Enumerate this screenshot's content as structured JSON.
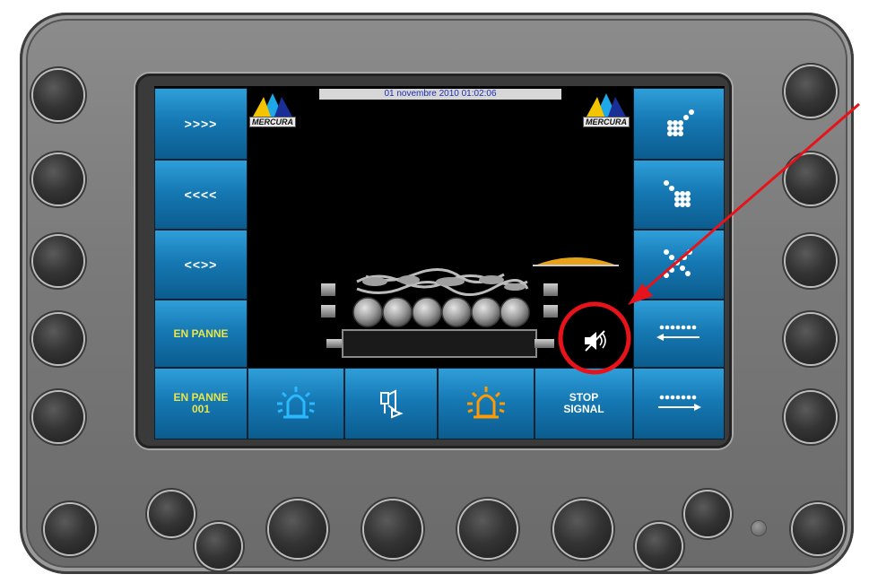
{
  "display": {
    "datetime": "01 novembre 2010 01:02:06",
    "logo_text": "MERCURA"
  },
  "left_buttons": [
    {
      "label": ">>>>"
    },
    {
      "label": "<<<<"
    },
    {
      "label": "<<>>"
    },
    {
      "label": "EN PANNE"
    },
    {
      "label": "EN PANNE\n001"
    }
  ],
  "bottom_buttons": [
    {
      "icon": "blue-beacon-icon"
    },
    {
      "icon": "horn-icon"
    },
    {
      "icon": "orange-beacon-icon"
    },
    {
      "label": "STOP\nSIGNAL"
    }
  ],
  "right_buttons": [
    {
      "icon": "dots-diagonal-up-icon"
    },
    {
      "icon": "dots-diagonal-down-icon"
    },
    {
      "icon": "dots-cross-icon"
    },
    {
      "icon": "arrow-left-dots-icon"
    },
    {
      "icon": "arrow-right-dots-icon"
    }
  ],
  "status": {
    "icon": "speaker-muted-icon"
  },
  "colors": {
    "button_blue": "#1679b4",
    "label_yellow": "#e8e54a",
    "date_text": "#1b2fb5",
    "annotation_red": "#e8121a",
    "beacon_blue": "#2ab8ff",
    "beacon_orange": "#ff9a00"
  }
}
